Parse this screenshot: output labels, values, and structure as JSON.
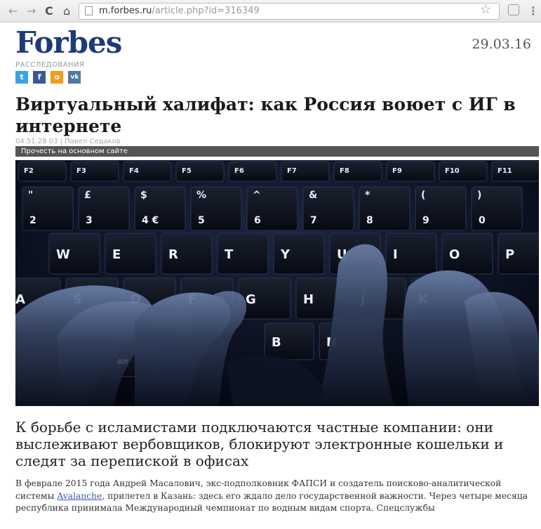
{
  "browser": {
    "back_icon": "back-arrow-icon",
    "forward_icon": "forward-arrow-icon",
    "reload_label": "C",
    "home_icon": "home-icon",
    "url_host": "m.forbes.ru",
    "url_path": "/article.php?id=316349"
  },
  "header": {
    "logo": "Forbes",
    "date": "29.03.16",
    "brand_color": "#1d3a7a"
  },
  "section": "РАССЛЕДОВАНИЯ",
  "social": {
    "twitter": "t",
    "facebook": "f",
    "ok": "o",
    "vk": "vk"
  },
  "article": {
    "headline": "Виртуальный халифат: как Россия воюет с ИГ в интернете",
    "byline": "04.51.28 03 | Павел Седаков",
    "read_bar": "Прочесть на основном сайте",
    "lede": "К борьбе с исламистами подключаются частные компании: они выслеживают вербовщиков, блокируют электронные кошельки и следят за перепиской в офисах",
    "body_before_link": "В феврале 2015 года Андрей Масалович, экс-подполковник ФАПСИ и создатель поисково-аналитической системы ",
    "body_link": "Avalanche",
    "body_after_link": ", прилетел в Казань: здесь его ждало дело государственной важности. Через четыре месяца республика принимала Международный чемпионат по водным видам спорта. Спецслужбы"
  },
  "hero_keys": {
    "fn_row": [
      "F2",
      "F3",
      "F4",
      "F5",
      "F6",
      "F7",
      "F8",
      "F9",
      "F10",
      "F11"
    ],
    "num_row_top": [
      "\"",
      "£",
      "$",
      "%",
      "^",
      "&",
      "*",
      "(",
      ")"
    ],
    "num_row_bottom": [
      "2",
      "3",
      "4 €",
      "5",
      "6",
      "7",
      "8",
      "9",
      "0"
    ],
    "q_row": [
      "W",
      "E",
      "R",
      "T",
      "Y",
      "U",
      "I",
      "O",
      "P"
    ],
    "a_row": [
      "A",
      "S",
      "D",
      "F",
      "G",
      "H",
      "J",
      "K"
    ],
    "z_row": [
      "B",
      "N"
    ],
    "alt_label": "Alt"
  }
}
